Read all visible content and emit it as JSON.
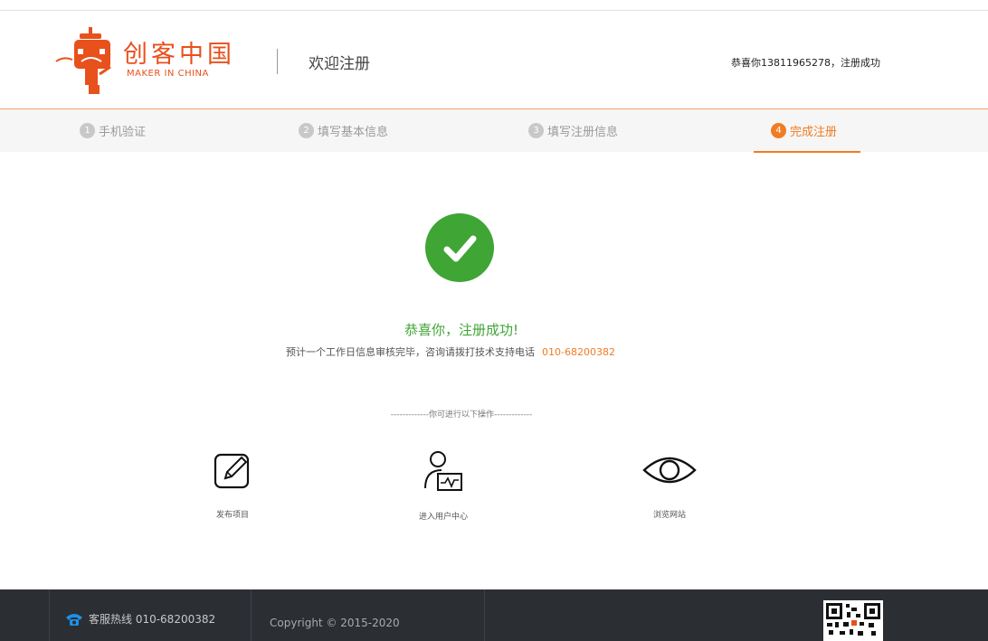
{
  "header": {
    "logo_title": "创客中国",
    "logo_subtitle": "MAKER IN CHINA",
    "welcome": "欢迎注册",
    "message": "恭喜你13811965278，注册成功"
  },
  "steps": [
    {
      "num": "1",
      "label": "手机验证"
    },
    {
      "num": "2",
      "label": "填写基本信息"
    },
    {
      "num": "3",
      "label": "填写注册信息"
    },
    {
      "num": "4",
      "label": "完成注册"
    }
  ],
  "result": {
    "title": "恭喜你，注册成功!",
    "note": "预计一个工作日信息审核完毕，咨询请拨打技术支持电话",
    "phone": "010-68200382"
  },
  "operations": {
    "separator": "-------------你可进行以下操作-------------",
    "actions": [
      {
        "label": "发布项目",
        "icon": "edit-icon"
      },
      {
        "label": "进入用户中心",
        "icon": "user-center-icon"
      },
      {
        "label": "浏览网站",
        "icon": "eye-icon"
      }
    ]
  },
  "footer": {
    "hotline": "客服热线 010-68200382",
    "copyright": "Copyright © 2015-2020"
  },
  "colors": {
    "brand": "#e8501c",
    "accent": "#f07c24",
    "success": "#3fa535",
    "footer_bg": "#2b2e33"
  }
}
